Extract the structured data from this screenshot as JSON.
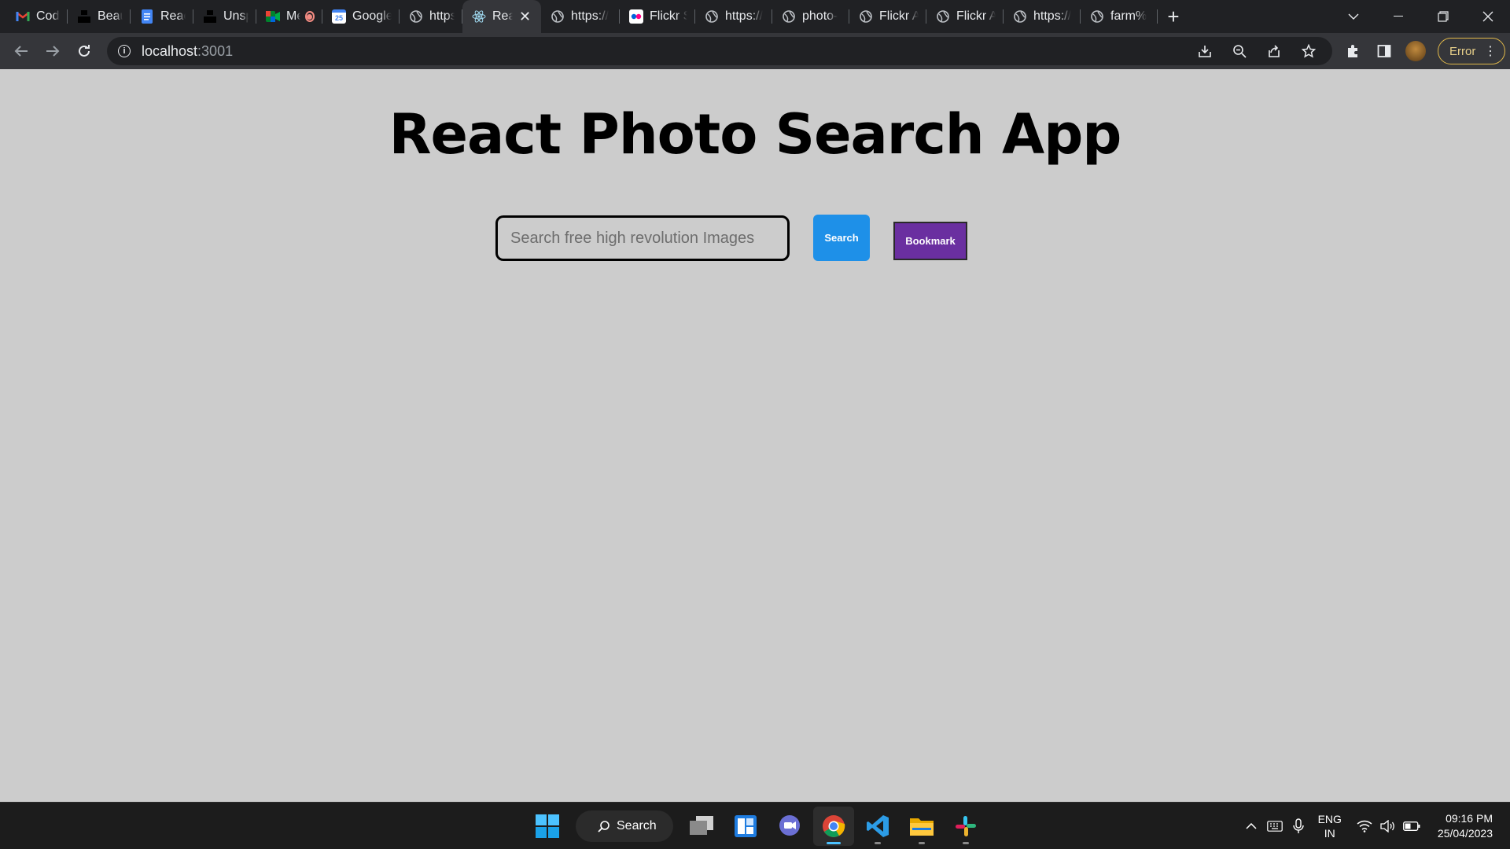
{
  "browser": {
    "tabs": [
      {
        "label": "Coding",
        "icon": "gmail-icon"
      },
      {
        "label": "Beautif",
        "icon": "unsplash-icon"
      },
      {
        "label": "React -",
        "icon": "docs-icon"
      },
      {
        "label": "Unspla",
        "icon": "unsplash-icon"
      },
      {
        "label": "Me",
        "icon": "meet-icon"
      },
      {
        "label": "Google",
        "icon": "calendar-icon"
      },
      {
        "label": "https://",
        "icon": "globe-icon"
      },
      {
        "label": "Rea",
        "icon": "react-icon",
        "active": true
      },
      {
        "label": "https://",
        "icon": "globe-icon"
      },
      {
        "label": "Flickr S",
        "icon": "flickr-icon"
      },
      {
        "label": "https://",
        "icon": "globe-icon"
      },
      {
        "label": "photo-",
        "icon": "globe-icon"
      },
      {
        "label": "Flickr A",
        "icon": "globe-icon"
      },
      {
        "label": "Flickr A",
        "icon": "globe-icon"
      },
      {
        "label": "https://",
        "icon": "globe-icon"
      },
      {
        "label": "farm%",
        "icon": "globe-icon"
      }
    ],
    "calendar_badge": "25",
    "address": {
      "host": "localhost",
      "port": ":3001"
    },
    "error_label": "Error"
  },
  "page": {
    "title": "React Photo Search App",
    "search_placeholder": "Search free high revolution Images",
    "search_value": "",
    "search_button": "Search",
    "bookmark_button": "Bookmark",
    "colors": {
      "background": "#cccccc",
      "search_button": "#1e90e8",
      "bookmark_button": "#6a2fa0"
    }
  },
  "taskbar": {
    "search_label": "Search",
    "lang_line1": "ENG",
    "lang_line2": "IN",
    "time": "09:16 PM",
    "date": "25/04/2023"
  }
}
